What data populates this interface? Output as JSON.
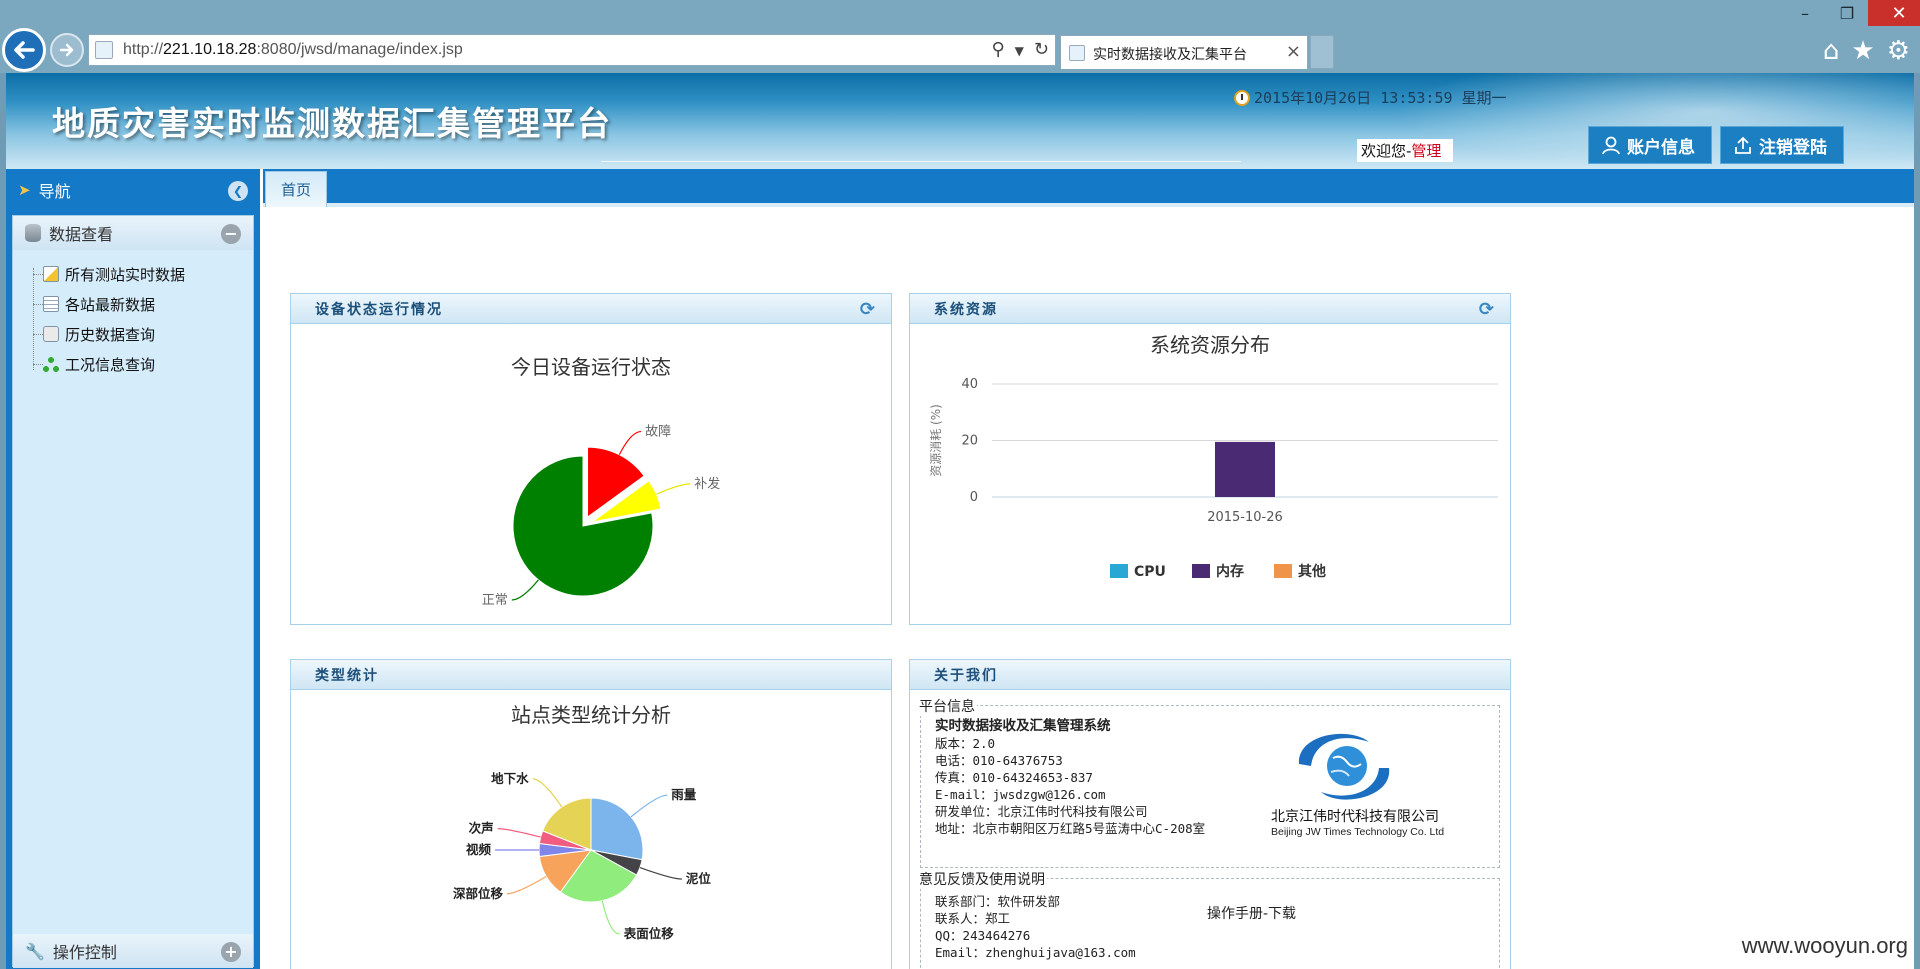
{
  "browser": {
    "url_prefix": "http://",
    "url_host": "221.10.18.28",
    "url_rest": ":8080/jwsd/manage/index.jsp",
    "tab_title": "实时数据接收及汇集平台"
  },
  "header": {
    "title": "地质灾害实时监测数据汇集管理平台",
    "datetime": "2015年10月26日 13:53:59 星期一",
    "welcome_prefix": "欢迎您-",
    "username": "管理",
    "account_button": "账户信息",
    "logout_button": "注销登陆"
  },
  "sidebar": {
    "title": "导航",
    "group_view": "数据查看",
    "items": [
      "所有测站实时数据",
      "各站最新数据",
      "历史数据查询",
      "工况信息查询"
    ],
    "group_control": "操作控制"
  },
  "main": {
    "tab_home": "首页"
  },
  "panels": {
    "device": {
      "title": "设备状态运行情况"
    },
    "resource": {
      "title": "系统资源"
    },
    "type": {
      "title": "类型统计"
    },
    "about": {
      "title": "关于我们"
    }
  },
  "chart_data": [
    {
      "type": "pie",
      "title": "今日设备运行状态",
      "slices": [
        {
          "label": "故障",
          "value": 15,
          "color": "#ff0000",
          "exploded": true
        },
        {
          "label": "补发",
          "value": 7,
          "color": "#ffff00",
          "exploded": true
        },
        {
          "label": "正常",
          "value": 78,
          "color": "#008000",
          "exploded": false
        }
      ]
    },
    {
      "type": "bar",
      "title": "系统资源分布",
      "ylabel": "资源消耗 (%)",
      "categories": [
        "2015-10-26"
      ],
      "series": [
        {
          "name": "CPU",
          "values": [
            0
          ],
          "color": "#29a8d6"
        },
        {
          "name": "内存",
          "values": [
            19.5
          ],
          "color": "#4b2a74"
        },
        {
          "name": "其他",
          "values": [
            0
          ],
          "color": "#f0944a"
        }
      ],
      "yticks": [
        0,
        20,
        40
      ],
      "ylim": [
        0,
        40
      ],
      "legend": "bottom"
    },
    {
      "type": "pie",
      "title": "站点类型统计分析",
      "slices": [
        {
          "label": "雨量",
          "value": 28,
          "color": "#7cb5ec"
        },
        {
          "label": "泥位",
          "value": 5,
          "color": "#434348"
        },
        {
          "label": "表面位移",
          "value": 27,
          "color": "#90ed7d"
        },
        {
          "label": "深部位移",
          "value": 13,
          "color": "#f7a35c"
        },
        {
          "label": "视频",
          "value": 4,
          "color": "#8085e9"
        },
        {
          "label": "次声",
          "value": 4,
          "color": "#f15c80"
        },
        {
          "label": "地下水",
          "value": 19,
          "color": "#e4d354"
        }
      ]
    }
  ],
  "about": {
    "platform_legend": "平台信息",
    "system_name": "实时数据接收及汇集管理系统",
    "lines": [
      "版本：2.0",
      "电话：010-64376753",
      "传真：010-64324653-837",
      "E-mail：jwsdzgw@126.com",
      "研发单位：北京江伟时代科技有限公司",
      "地址：北京市朝阳区万红路5号蓝涛中心C-208室"
    ],
    "company_name": "北京江伟时代科技有限公司",
    "company_en": "Beijing JW Times Technology Co. Ltd",
    "feedback_legend": "意见反馈及使用说明",
    "feedback_lines": [
      "联系部门：软件研发部",
      "联系人：郑工",
      "QQ：243464276",
      "Email：zhenghuijava@163.com"
    ],
    "manual_link": "操作手册-下载"
  },
  "watermark": "www.wooyun.org",
  "icons": {
    "back": "arrow-left-icon",
    "forward": "arrow-right-icon",
    "search": "search-icon",
    "refresh": "refresh-icon",
    "home": "home-icon",
    "favorites": "star-icon",
    "settings": "gear-icon"
  }
}
